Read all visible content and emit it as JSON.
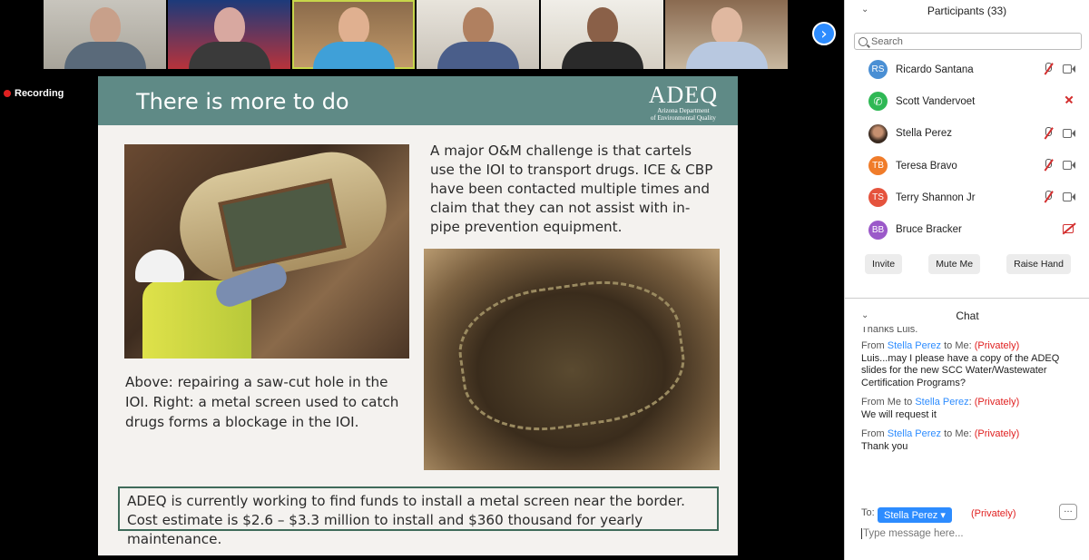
{
  "recording": {
    "label": "Recording"
  },
  "video_strip": {
    "next_icon": "›"
  },
  "slide": {
    "title": "There is more to do",
    "logo": {
      "name": "ADEQ",
      "subtitle_line1": "Arizona Department",
      "subtitle_line2": "of Environmental Quality"
    },
    "top_right_text": "A major O&M challenge is that cartels use the IOI to transport drugs. ICE & CBP have been contacted multiple times and claim that they can not assist with in-pipe prevention equipment.",
    "left_caption": "Above: repairing a saw-cut hole in the IOI. Right: a metal screen used to catch drugs forms a blockage in the IOI.",
    "callout": "ADEQ is currently working to find funds to install a metal screen near the border. Cost estimate is $2.6 – $3.3 million to install and $360 thousand for yearly maintenance."
  },
  "participants": {
    "title": "Participants (33)",
    "search_placeholder": "Search",
    "list": [
      {
        "initials": "RS",
        "name": "Ricardo Santana",
        "color": "#4a8fd4",
        "mic": "muted",
        "cam": "on"
      },
      {
        "initials": "",
        "name": "Scott Vandervoet",
        "color": "#2fb855",
        "mic": "phone",
        "cam": "none"
      },
      {
        "initials": "",
        "name": "Stella Perez",
        "color": "#c69070",
        "mic": "muted",
        "cam": "on"
      },
      {
        "initials": "TB",
        "name": "Teresa Bravo",
        "color": "#f07c2a",
        "mic": "muted",
        "cam": "on"
      },
      {
        "initials": "TS",
        "name": "Terry Shannon Jr",
        "color": "#e5533d",
        "mic": "muted",
        "cam": "on"
      },
      {
        "initials": "BB",
        "name": "Bruce Bracker",
        "color": "#9b59c9",
        "mic": "none",
        "cam": "off"
      }
    ],
    "invite_label": "Invite",
    "mute_label": "Mute Me",
    "raise_label": "Raise Hand"
  },
  "chat": {
    "title": "Chat",
    "cut_text": "Thanks Luis.",
    "messages": [
      {
        "from": "Stella Perez",
        "to": "Me",
        "privacy": "(Privately)",
        "text": "Luis...may I please have a copy of the ADEQ slides for the new SCC Water/Wastewater Certification Programs?"
      },
      {
        "from": "Me",
        "to": "Stella Perez",
        "privacy": "(Privately)",
        "text": "We will request it"
      },
      {
        "from": "Stella Perez",
        "to": "Me",
        "privacy": "(Privately)",
        "text": "Thank you"
      }
    ],
    "to_label": "To:",
    "recipient": "Stella Perez",
    "recipient_privacy": "(Privately)",
    "more_label": "…",
    "input_placeholder": "Type message here..."
  }
}
